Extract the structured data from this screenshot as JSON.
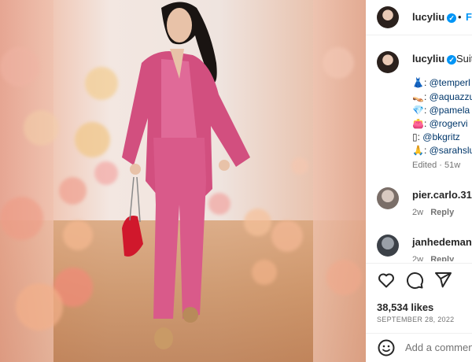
{
  "post": {
    "image_alt": "Woman in pink velvet suit walking",
    "author": "lucyliu",
    "follow_label": "Fo",
    "separator": "•"
  },
  "caption": {
    "author": "lucyliu",
    "text": "Suit",
    "mentions": [
      {
        "emoji": "👗",
        "handle": "@temperl"
      },
      {
        "emoji": "👡",
        "handle": "@aquazzu"
      },
      {
        "emoji": "💎",
        "handle": "@pamela"
      },
      {
        "emoji": "👛",
        "handle": "@rogervi"
      },
      {
        "emoji": "▯",
        "handle": "@bkgritz"
      },
      {
        "emoji": "🙏",
        "handle": "@sarahslu"
      }
    ],
    "edited": "Edited",
    "age": "51w"
  },
  "comments": [
    {
      "user": "pier.carlo.31",
      "age": "2w",
      "reply": "Reply"
    },
    {
      "user": "janhedemand",
      "age": "2w",
      "reply": "Reply"
    }
  ],
  "stats": {
    "likes": "38,534 likes",
    "date": "SEPTEMBER 28, 2022"
  },
  "composer": {
    "placeholder": "Add a commen"
  },
  "colors": {
    "accent": "#0095f6",
    "suit": "#d9608f",
    "verified": "#0095f6"
  }
}
